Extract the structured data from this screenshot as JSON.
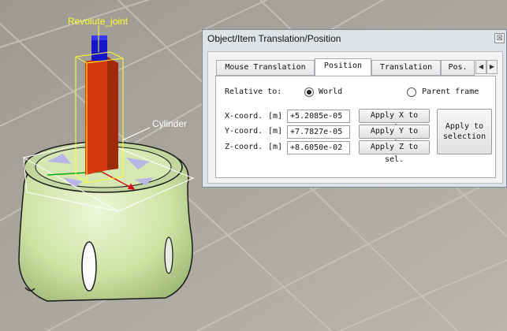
{
  "scene": {
    "labels": {
      "joint": "Revolute_joint",
      "shape": "Cylinder"
    },
    "colors": {
      "joint_label": "#ffff33",
      "shape_label": "#ffffff",
      "body": "#cfe3a5",
      "joint_red": "#d4380d",
      "joint_blue": "#1515c8"
    }
  },
  "dialog": {
    "title": "Object/Item Translation/Position",
    "close_icon": "close-icon",
    "tabs": [
      "Mouse Translation",
      "Position",
      "Translation",
      "Pos."
    ],
    "active_tab": "Position",
    "relative_to": {
      "label": "Relative to:",
      "options": [
        {
          "label": "World",
          "selected": true
        },
        {
          "label": "Parent frame",
          "selected": false
        }
      ]
    },
    "coords": [
      {
        "label": "X-coord.",
        "unit": "[m]",
        "value": "+5.2085e-05",
        "button": "Apply X to sel."
      },
      {
        "label": "Y-coord.",
        "unit": "[m]",
        "value": "+7.7827e-05",
        "button": "Apply Y to sel."
      },
      {
        "label": "Z-coord.",
        "unit": "[m]",
        "value": "+8.6050e-02",
        "button": "Apply Z to sel."
      }
    ],
    "apply_selection": "Apply to\nselection"
  }
}
